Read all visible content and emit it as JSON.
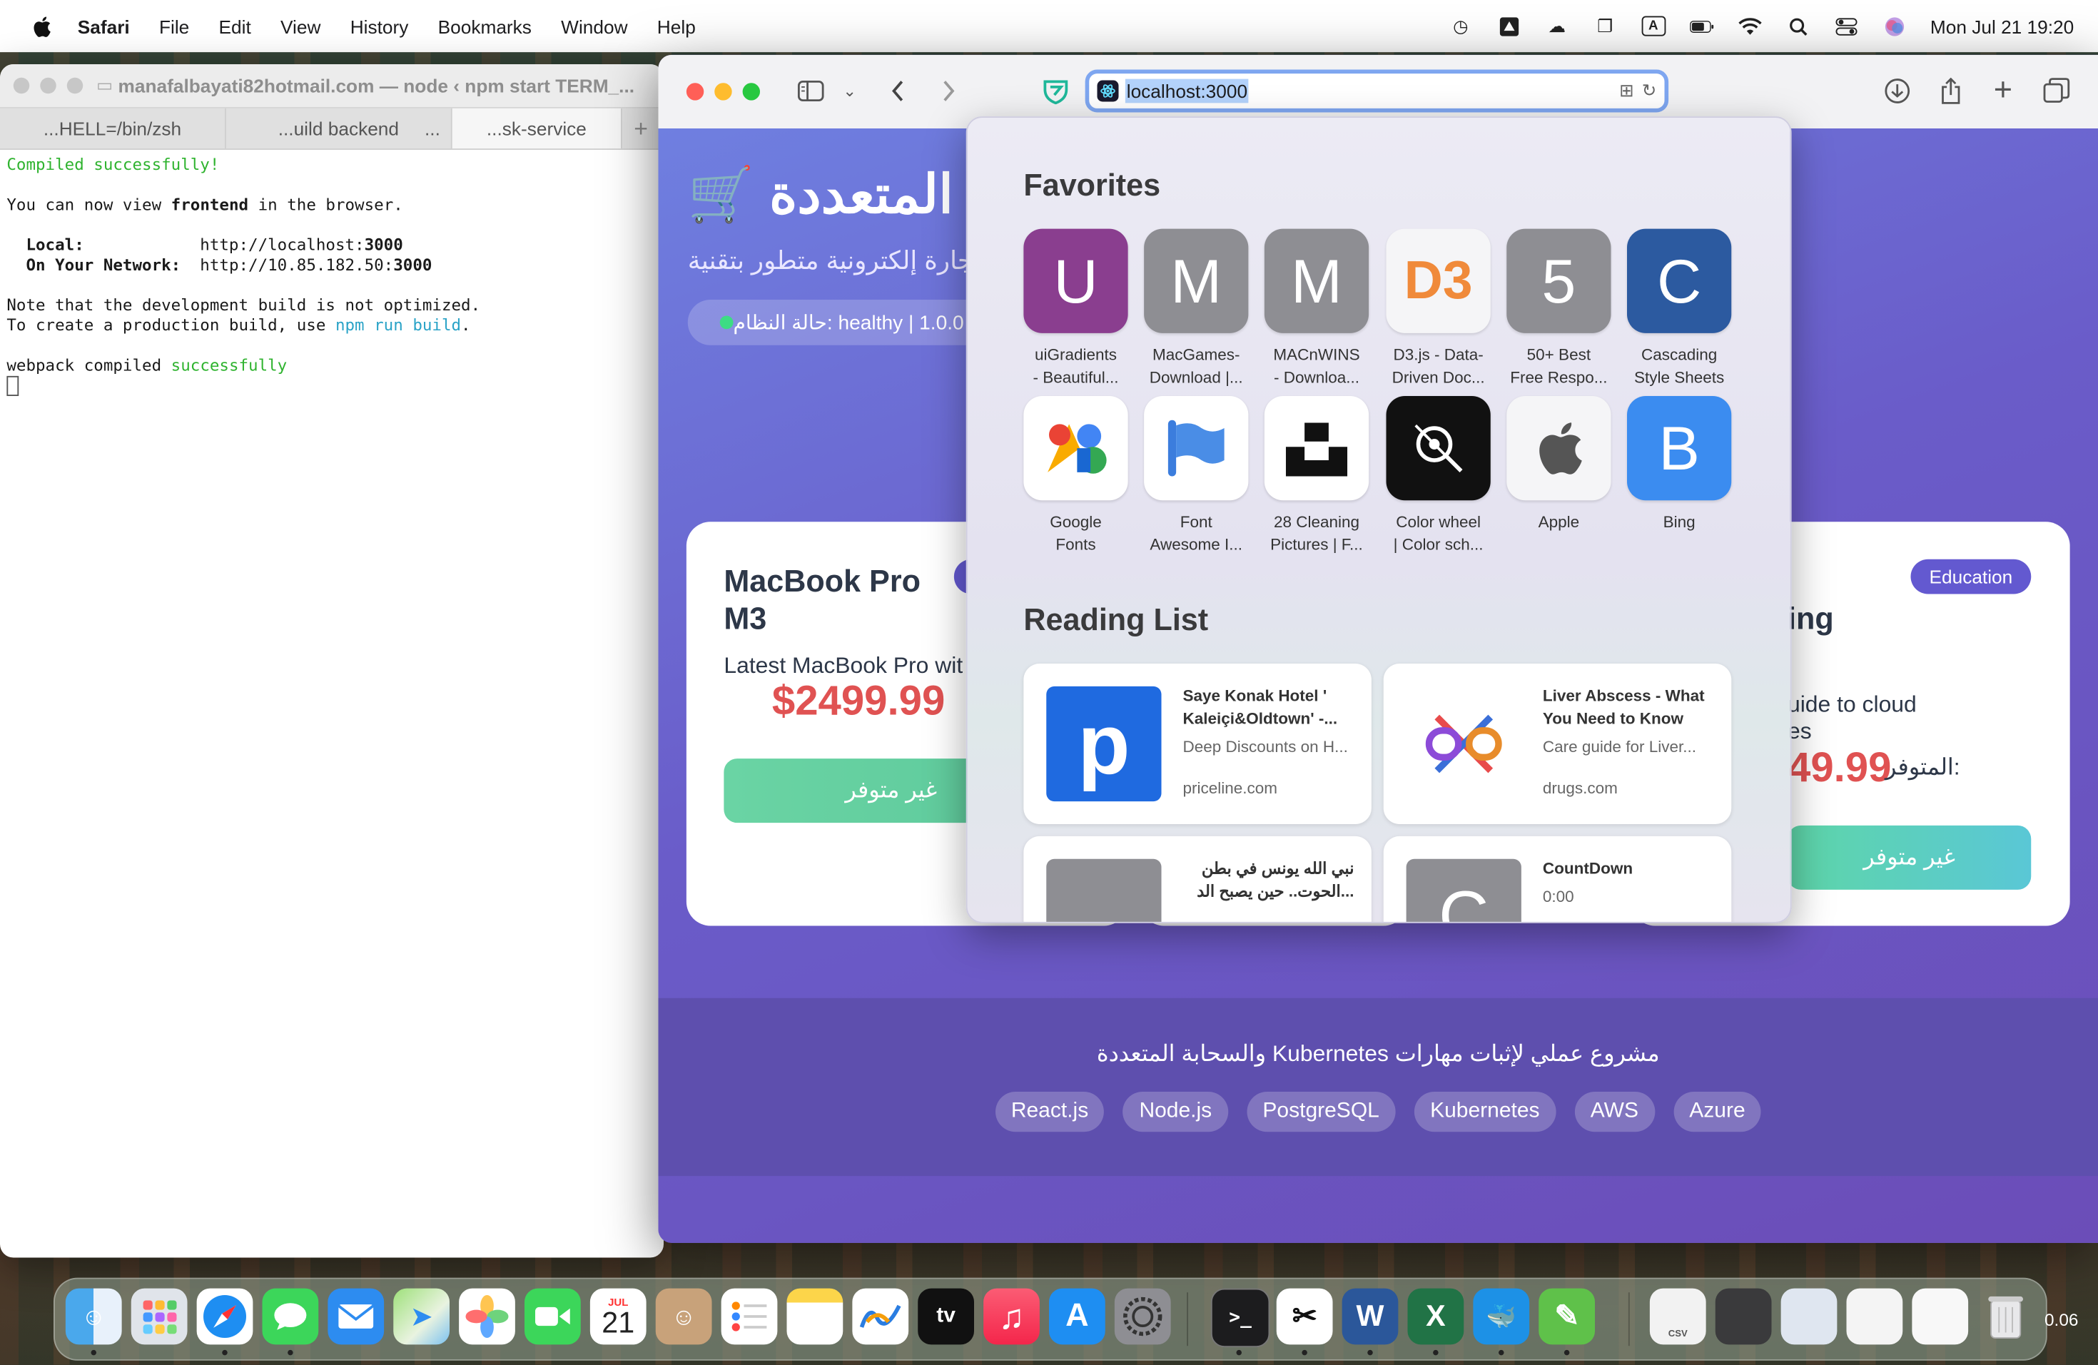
{
  "menubar": {
    "app": "Safari",
    "items": [
      "File",
      "Edit",
      "View",
      "History",
      "Bookmarks",
      "Window",
      "Help"
    ],
    "input_indicator": "A",
    "clock": "Mon Jul 21  19:20"
  },
  "terminal": {
    "title": "manafalbayati82hotmail.com — node ‹ npm start TERM_...",
    "tabs": [
      "...HELL=/bin/zsh",
      "...uild backend",
      "...sk-service"
    ],
    "tab_more": "...",
    "tab_add": "+",
    "lines": {
      "l1": "Compiled successfully!",
      "l2a": "You can now view ",
      "l2b": "frontend",
      "l2c": " in the browser.",
      "l3a": "  Local:",
      "l3b": "            http://localhost:",
      "l3c": "3000",
      "l4a": "  On Your Network:",
      "l4b": "  http://10.85.182.50:",
      "l4c": "3000",
      "l5": "Note that the development build is not optimized.",
      "l6a": "To create a production build, use ",
      "l6b": "npm run build",
      "l6c": ".",
      "l7a": "webpack compiled ",
      "l7b": "successfully"
    }
  },
  "safari": {
    "url": "localhost:3000",
    "page": {
      "hero_title": "🛒 المتعددة",
      "hero_subtitle": "تجارة إلكترونية متطور بتقنية",
      "status": "حالة النظام: healthy | 1.0.0",
      "card1": {
        "title": "MacBook Pro M3",
        "desc": "Latest MacBook Pro wit",
        "price": "$2499.99",
        "button": "غير متوفر"
      },
      "card3": {
        "badge": "Education",
        "title": "ing",
        "desc1": "uide to cloud",
        "desc2": "es",
        "price": "49.99",
        "avail": "المتوفر:",
        "button": "غير متوفر"
      },
      "footer_text": "والسحابة المتعددة Kubernetes مشروع عملي لإثبات مهارات",
      "techs": [
        "React.js",
        "Node.js",
        "PostgreSQL",
        "Kubernetes",
        "AWS",
        "Azure"
      ]
    },
    "popover": {
      "favorites_heading": "Favorites",
      "favorites": [
        {
          "letter": "U",
          "label1": "uiGradients",
          "label2": "- Beautiful...",
          "color": "#8a3e8f"
        },
        {
          "letter": "M",
          "label1": "MacGames-",
          "label2": "Download |...",
          "color": "#8e8e93"
        },
        {
          "letter": "M",
          "label1": "MACnWINS",
          "label2": "- Downloa...",
          "color": "#8e8e93"
        },
        {
          "letter": "D3",
          "label1": "D3.js - Data-",
          "label2": "Driven Doc...",
          "color": "#f5f5f7"
        },
        {
          "letter": "5",
          "label1": "50+ Best",
          "label2": "Free Respo...",
          "color": "#8e8e93"
        },
        {
          "letter": "C",
          "label1": "Cascading",
          "label2": "Style Sheets",
          "color": "#2c5aa0"
        },
        {
          "letter": "",
          "label1": "Google",
          "label2": "Fonts",
          "color": "#ffffff"
        },
        {
          "letter": "",
          "label1": "Font",
          "label2": "Awesome I...",
          "color": "#ffffff"
        },
        {
          "letter": "",
          "label1": "28 Cleaning",
          "label2": "Pictures | F...",
          "color": "#ffffff"
        },
        {
          "letter": "",
          "label1": "Color wheel",
          "label2": "| Color sch...",
          "color": "#111111"
        },
        {
          "letter": "",
          "label1": "Apple",
          "label2": "",
          "color": "#f5f5f7"
        },
        {
          "letter": "B",
          "label1": "Bing",
          "label2": "",
          "color": "#3b8cf0"
        }
      ],
      "reading_heading": "Reading List",
      "reading": [
        {
          "title": "Saye Konak Hotel ' Kaleiçi&Oldtown' -...",
          "desc": "Deep Discounts on H...",
          "site": "priceline.com",
          "thumb_letter": "p"
        },
        {
          "title": "Liver Abscess - What You Need to Know",
          "desc": "Care guide for Liver...",
          "site": "drugs.com",
          "thumb_letter": ""
        },
        {
          "title": "نبي الله يونس في بطن الحوت.. حين يصبح الد...",
          "desc": "",
          "site": "",
          "thumb_letter": ""
        },
        {
          "title": "CountDown",
          "desc": "0:00",
          "site": "",
          "thumb_letter": "C"
        }
      ]
    }
  },
  "dock": {
    "calendar_month": "JUL",
    "calendar_day": "21",
    "time_fragment": "0.06",
    "apps": [
      "Finder",
      "Launchpad",
      "Safari",
      "Messages",
      "Mail",
      "Maps",
      "Photos",
      "FaceTime",
      "Calendar",
      "Contacts",
      "Reminders",
      "Notes",
      "Freeform",
      "TV",
      "Music",
      "App Store",
      "System Settings",
      "Terminal",
      "CapCut",
      "Word",
      "Excel",
      "Docker",
      "Numbers"
    ],
    "tv_label": "tv",
    "word_letter": "W",
    "excel_letter": "X",
    "csv_label": "CSV"
  }
}
